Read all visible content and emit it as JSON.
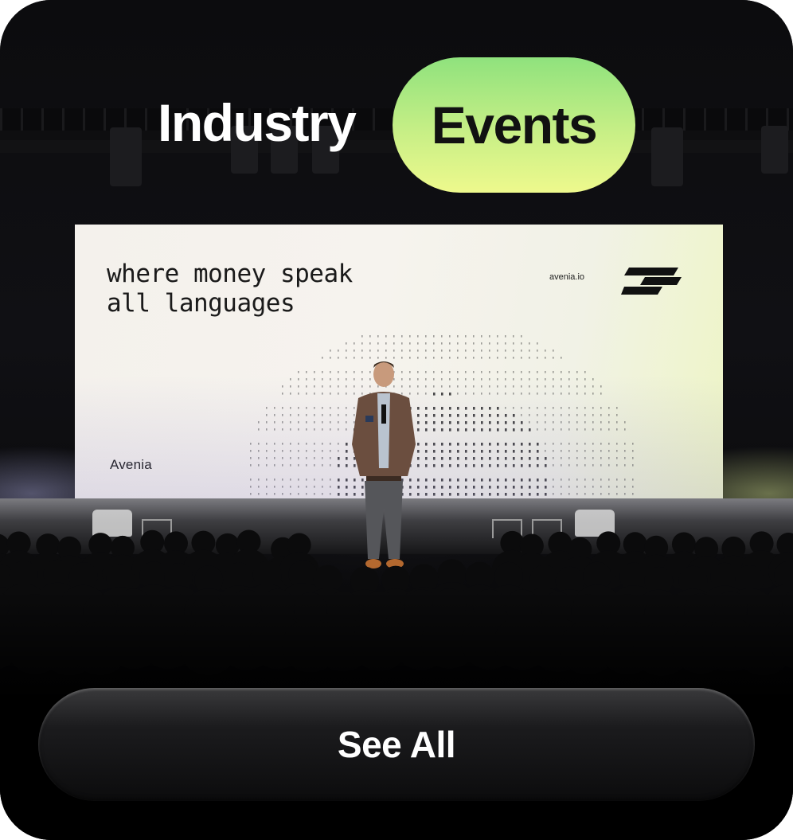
{
  "card": {
    "title_word_1": "Industry",
    "title_word_2": "Events",
    "accent_gradient": [
      "#8fe27d",
      "#eef98d"
    ],
    "background": "#050505"
  },
  "stage_screen": {
    "tagline_line_1": "where money speak",
    "tagline_line_2": "all languages",
    "url": "avenia.io",
    "brand": "Avenia",
    "brand_mark_icon": "avenia-mark-icon"
  },
  "actions": {
    "see_all_label": "See All"
  }
}
